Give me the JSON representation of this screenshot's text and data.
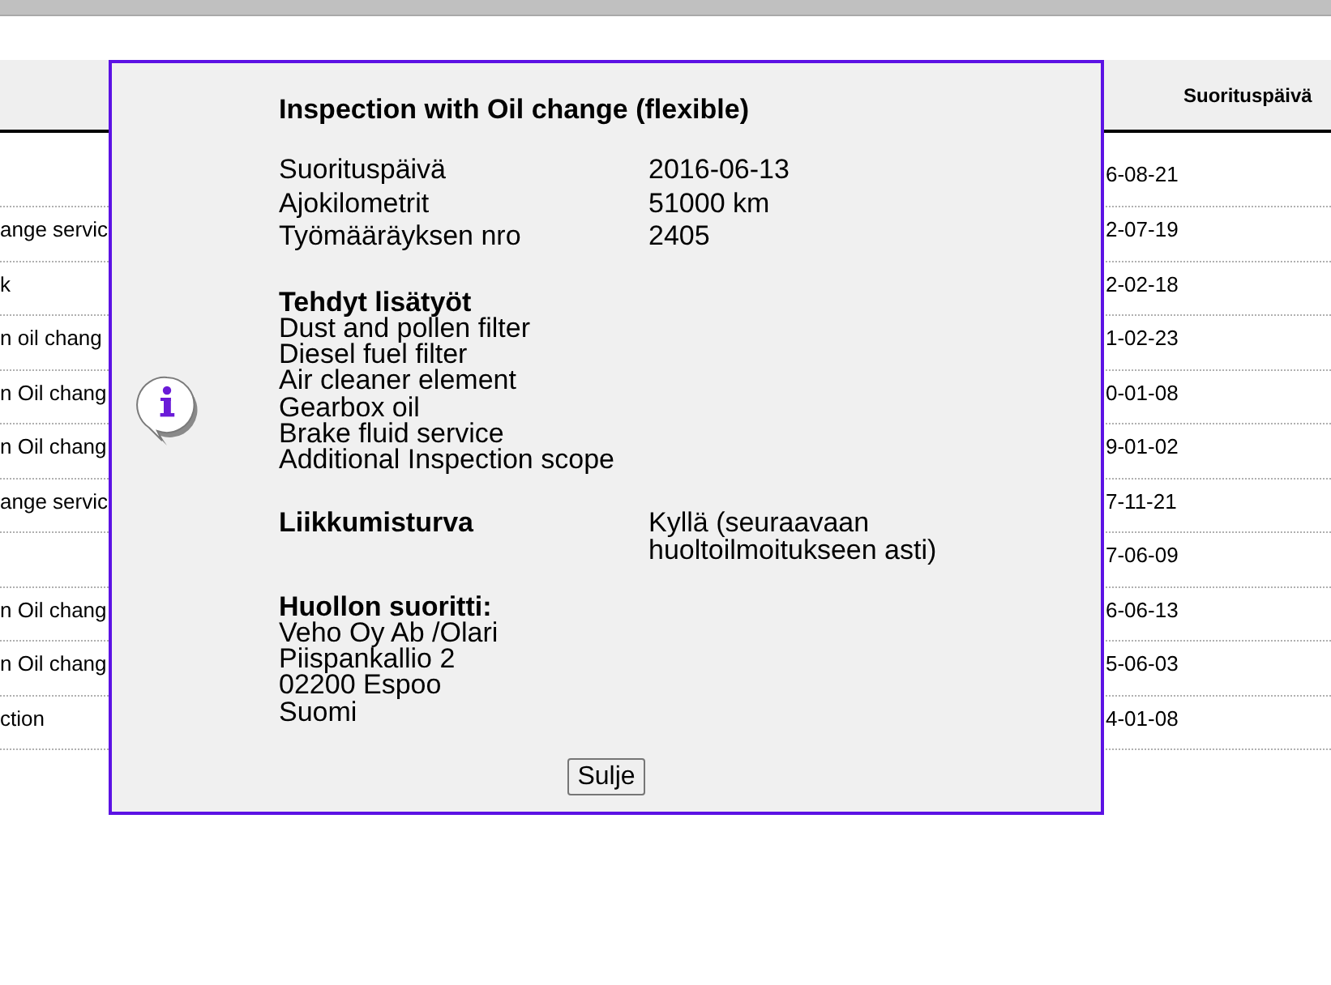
{
  "table": {
    "date_header": "Suorituspäivä",
    "rows": [
      {
        "date": "6-08-21"
      },
      {
        "column_1": "ange servic",
        "date": "2-07-19"
      },
      {
        "column_1": "k",
        "date": "2-02-18"
      },
      {
        "column_1": "n oil chang",
        "date": "1-02-23"
      },
      {
        "column_1": "n Oil chang",
        "date": "0-01-08"
      },
      {
        "column_1": "n Oil chang",
        "date": "9-01-02"
      },
      {
        "column_1": "ange servic",
        "date": "7-11-21"
      },
      {
        "date": "7-06-09"
      },
      {
        "column_1": "n Oil chang",
        "date": "6-06-13"
      },
      {
        "column_1": "n Oil chang",
        "date": "5-06-03"
      },
      {
        "column_1": "ction",
        "date": "4-01-08"
      }
    ]
  },
  "dialog": {
    "title": "Inspection with Oil change (flexible)",
    "fields": [
      {
        "label": "Suorituspäivä",
        "value": "2016-06-13"
      },
      {
        "label": "Ajokilometrit",
        "value": "51000 km"
      },
      {
        "label": "Työmääräyksen nro",
        "value": "2405"
      }
    ],
    "extra_work": {
      "heading": "Tehdyt lisätyöt",
      "items": [
        "Dust and pollen filter",
        "Diesel fuel filter",
        "Air cleaner element",
        "Gearbox oil",
        "Brake fluid service",
        "Additional Inspection scope"
      ]
    },
    "mobility_guarantee": {
      "label": "Liikkumisturva",
      "value": "Kyllä (seuraavaan huoltoilmoitukseen asti)"
    },
    "service_provider": {
      "heading": "Huollon suoritti:",
      "lines": [
        "Veho Oy Ab /Olari",
        "Piispankallio 2",
        "02200 Espoo",
        "Suomi"
      ]
    },
    "close_button": "Sulje"
  }
}
